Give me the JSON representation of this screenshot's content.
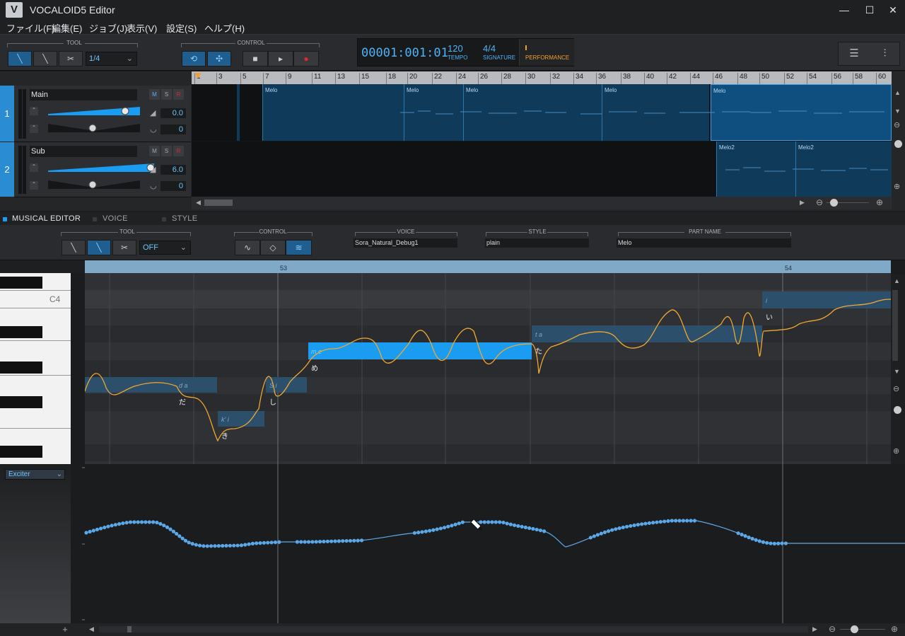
{
  "app": {
    "title": "VOCALOID5 Editor",
    "logo": "V"
  },
  "window": {
    "minimize": "—",
    "maximize": "☐",
    "close": "✕"
  },
  "menu": [
    "ファイル(F)",
    "編集(E)",
    "ジョブ(J)",
    "表示(V)",
    "設定(S)",
    "ヘルプ(H)"
  ],
  "toolbar": {
    "tool_label": "TOOL",
    "quantize": "1/4",
    "control_label": "CONTROL"
  },
  "transport": {
    "position": "00001:001:01",
    "tempo": "120",
    "tempo_label": "TEMPO",
    "signature": "4/4",
    "signature_label": "SIGNATURE",
    "performance_label": "PERFORMANCE"
  },
  "tracks": [
    {
      "number": "1",
      "name": "Main",
      "m": "M",
      "s": "S",
      "r": "R",
      "volume": "0.0",
      "pan": "0",
      "volume_level": 0.6,
      "pan_level": 0.5
    },
    {
      "number": "2",
      "name": "Sub",
      "m": "M",
      "s": "S",
      "r": "R",
      "volume": "6.0",
      "pan": "0",
      "volume_level": 0.7,
      "pan_level": 0.5
    }
  ],
  "ruler": [
    "1",
    "3",
    "5",
    "7",
    "9",
    "11",
    "13",
    "15",
    "18",
    "20",
    "22",
    "24",
    "26",
    "28",
    "30",
    "32",
    "34",
    "36",
    "38",
    "40",
    "42",
    "44",
    "46",
    "48",
    "50",
    "52",
    "54",
    "56",
    "58",
    "60"
  ],
  "parts": {
    "track1": [
      "Melo",
      "Melo",
      "Melo",
      "Melo",
      "Melo"
    ],
    "track2": [
      "Melo2",
      "Melo2"
    ]
  },
  "editor": {
    "tabs": [
      "MUSICAL EDITOR",
      "VOICE",
      "STYLE"
    ],
    "tool_label": "TOOL",
    "snap": "OFF",
    "control_label": "CONTROL",
    "voice_label": "VOICE",
    "voice": "Sora_Natural_Debug1",
    "style_label": "STYLE",
    "style": "plain",
    "part_name_label": "PART NAME",
    "part_name": "Melo",
    "measures": [
      "53",
      "54"
    ],
    "key_label": "C4"
  },
  "notes": [
    {
      "phoneme": "d a",
      "lyric": "だ"
    },
    {
      "phoneme": "k' i",
      "lyric": "き"
    },
    {
      "phoneme": "S i",
      "lyric": "し"
    },
    {
      "phoneme": "m e",
      "lyric": "め"
    },
    {
      "phoneme": "t a",
      "lyric": "た"
    },
    {
      "phoneme": "i",
      "lyric": "い"
    }
  ],
  "parameter": {
    "name": "Exciter",
    "add": "+"
  },
  "colors": {
    "accent": "#1a9cf0",
    "pitch": "#f0a830",
    "part": "#0f3a5a",
    "curve": "#5ba8e8",
    "perf": "#f0a030"
  }
}
